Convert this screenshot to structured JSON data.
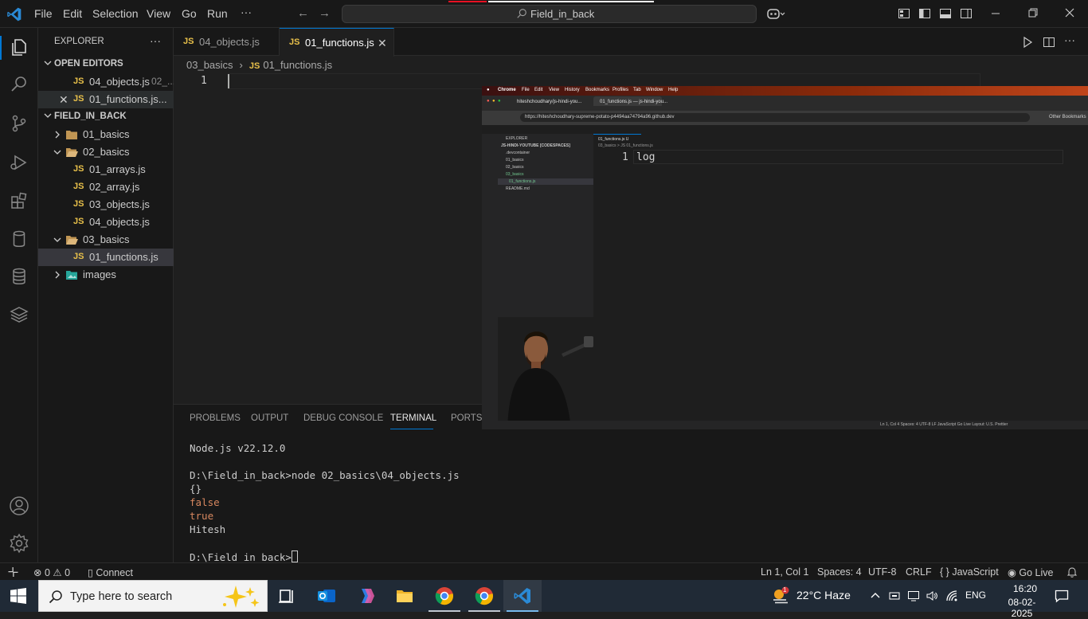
{
  "titlebar": {
    "menu": [
      "File",
      "Edit",
      "Selection",
      "View",
      "Go",
      "Run",
      "···"
    ],
    "search_text": "Field_in_back"
  },
  "sidebar": {
    "title": "EXPLORER",
    "more": "···",
    "open_editors_header": "OPEN EDITORS",
    "open_editors": [
      {
        "name": "04_objects.js",
        "dir": "02_..."
      },
      {
        "name": "01_functions.js..."
      }
    ],
    "workspace_header": "FIELD_IN_BACK",
    "tree": {
      "folder_01": "01_basics",
      "folder_02": "02_basics",
      "file_01_arrays": "01_arrays.js",
      "file_02_array": "02_array.js",
      "file_03_objects": "03_objects.js",
      "file_04_objects": "04_objects.js",
      "folder_03": "03_basics",
      "file_01_functions": "01_functions.js",
      "folder_images": "images"
    },
    "js_badge": "JS"
  },
  "tabs": [
    {
      "label": "04_objects.js"
    },
    {
      "label": "01_functions.js",
      "close": "✕"
    }
  ],
  "breadcrumb": {
    "folder": "03_basics",
    "file": "01_functions.js",
    "sep": "›"
  },
  "editor": {
    "line_number": "1"
  },
  "panel": {
    "tabs": [
      "PROBLEMS",
      "OUTPUT",
      "DEBUG CONSOLE",
      "TERMINAL",
      "PORTS"
    ],
    "terminal_lines": [
      "Node.js v22.12.0",
      "",
      "D:\\Field_in_back>node 02_basics\\04_objects.js",
      "{}",
      "false",
      "true",
      "Hitesh",
      "",
      "D:\\Field_in_back>"
    ]
  },
  "statusbar": {
    "problems": "0",
    "warnings": "0",
    "connect": "Connect",
    "position": "Ln 1, Col 1",
    "spaces": "Spaces: 4",
    "encoding": "UTF-8",
    "eol": "CRLF",
    "language": "JavaScript",
    "golive": "Go Live"
  },
  "overlay": {
    "mac_menu": [
      "Chrome",
      "File",
      "Edit",
      "View",
      "History",
      "Bookmarks",
      "Profiles",
      "Tab",
      "Window",
      "Help"
    ],
    "browser_tabs": [
      "hiteshchoudhary/js-hindi-you...",
      "01_functions.js — js-hindi-you..."
    ],
    "url": "https://hiteshchoudhary-supreme-potato-p4494aa74794a96.github.dev",
    "other_bookmarks": "Other Bookmarks",
    "sidebar_title": "EXPLORER",
    "sidebar_repo": "JS-HINDI-YOUTUBE [CODESPACES]",
    "sidebar_items": [
      ".devcontainer",
      "01_basics",
      "02_basics",
      "03_basics",
      "01_functions.js",
      "README.md"
    ],
    "editor_tab": "01_functions.js U",
    "editor_crumb": "03_basics > JS 01_functions.js",
    "line_number": "1",
    "code": "log",
    "status": "Ln 1, Col 4   Spaces: 4   UTF-8   LF   JavaScript   Go Live   Layout: U.S.   Prettier"
  },
  "taskbar": {
    "search_placeholder": "Type here to search",
    "weather": "22°C  Haze",
    "weather_badge": "1",
    "language": "ENG",
    "time": "16:20",
    "date": "08-02-2025"
  },
  "colors": {
    "accent": "#0078d4",
    "js_badge": "#e8c04a",
    "terminal_bool": "#d7875f"
  }
}
